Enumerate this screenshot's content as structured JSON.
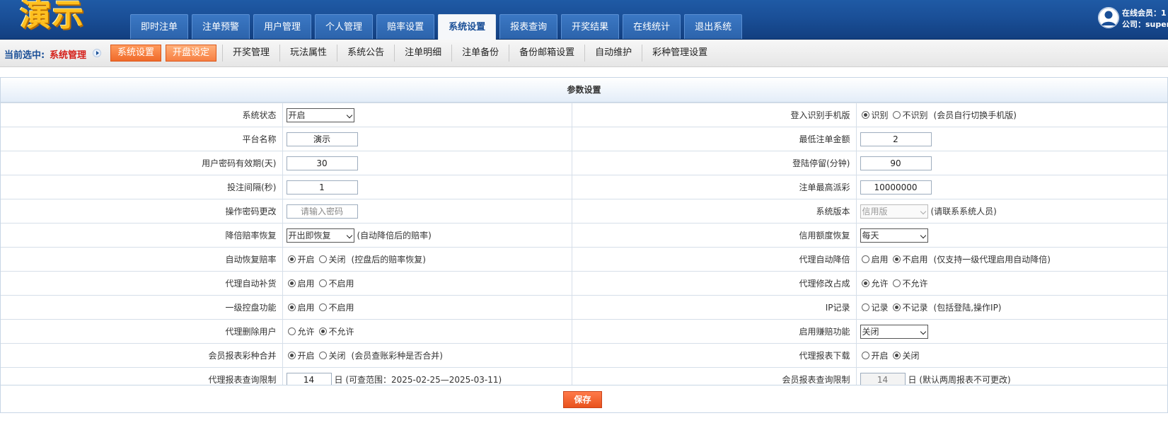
{
  "header": {
    "logo_text": "演示",
    "nav": [
      "即时注单",
      "注单预警",
      "用户管理",
      "个人管理",
      "赔率设置",
      "系统设置",
      "报表查询",
      "开奖结果",
      "在线统计",
      "退出系统"
    ],
    "active_nav": "系统设置",
    "online_label": "在线会员：1",
    "company_label": "公司：supers"
  },
  "subnav": {
    "current_label": "当前选中:",
    "current_value": "系统管理",
    "buttons": [
      "系统设置",
      "开盘设定"
    ],
    "links": [
      "开奖管理",
      "玩法属性",
      "系统公告",
      "注单明细",
      "注单备份",
      "备份邮箱设置",
      "自动维护",
      "彩种管理设置"
    ]
  },
  "panel": {
    "title": "参数设置",
    "rows": [
      {
        "left": {
          "label": "系统状态",
          "type": "select",
          "value": "开启"
        },
        "right": {
          "label": "登入识别手机版",
          "type": "radio",
          "options": [
            "识别",
            "不识别"
          ],
          "selected": 0,
          "note": "(会员自行切换手机版)"
        }
      },
      {
        "left": {
          "label": "平台名称",
          "type": "input",
          "value": "演示"
        },
        "right": {
          "label": "最低注单金额",
          "type": "input",
          "value": "2"
        }
      },
      {
        "left": {
          "label": "用户密码有效期(天)",
          "type": "input",
          "value": "30"
        },
        "right": {
          "label": "登陆停留(分钟)",
          "type": "input",
          "value": "90"
        }
      },
      {
        "left": {
          "label": "投注间隔(秒)",
          "type": "input",
          "value": "1"
        },
        "right": {
          "label": "注单最高派彩",
          "type": "input",
          "value": "10000000"
        }
      },
      {
        "left": {
          "label": "操作密码更改",
          "type": "input",
          "placeholder": "请输入密码"
        },
        "right": {
          "label": "系统版本",
          "type": "select-disabled",
          "value": "信用版",
          "note": "(请联系系统人员)"
        }
      },
      {
        "left": {
          "label": "降倍赔率恢复",
          "type": "select",
          "value": "开出即恢复",
          "note": "(自动降倍后的赔率)"
        },
        "right": {
          "label": "信用额度恢复",
          "type": "select",
          "value": "每天"
        }
      },
      {
        "left": {
          "label": "自动恢复赔率",
          "type": "radio",
          "options": [
            "开启",
            "关闭"
          ],
          "selected": 0,
          "note": "(控盘后的赔率恢复)"
        },
        "right": {
          "label": "代理自动降倍",
          "type": "radio",
          "options": [
            "启用",
            "不启用"
          ],
          "selected": 1,
          "note": "(仅支持一级代理启用自动降倍)"
        }
      },
      {
        "left": {
          "label": "代理自动补货",
          "type": "radio",
          "options": [
            "启用",
            "不启用"
          ],
          "selected": 0
        },
        "right": {
          "label": "代理修改占成",
          "type": "radio",
          "options": [
            "允许",
            "不允许"
          ],
          "selected": 0
        }
      },
      {
        "left": {
          "label": "一级控盘功能",
          "type": "radio",
          "options": [
            "启用",
            "不启用"
          ],
          "selected": 0
        },
        "right": {
          "label": "IP记录",
          "type": "radio",
          "options": [
            "记录",
            "不记录"
          ],
          "selected": 1,
          "note": "(包括登陆,操作IP)"
        }
      },
      {
        "left": {
          "label": "代理删除用户",
          "type": "radio",
          "options": [
            "允许",
            "不允许"
          ],
          "selected": 1
        },
        "right": {
          "label": "启用赚赔功能",
          "type": "select",
          "value": "关闭"
        }
      },
      {
        "left": {
          "label": "会员报表彩种合并",
          "type": "radio",
          "options": [
            "开启",
            "关闭"
          ],
          "selected": 0,
          "note": "(会员查账彩种是否合并)"
        },
        "right": {
          "label": "代理报表下载",
          "type": "radio",
          "options": [
            "开启",
            "关闭"
          ],
          "selected": 1
        }
      },
      {
        "left": {
          "label": "代理报表查询限制",
          "type": "input",
          "value": "14",
          "note": "日 (可查范围：2025-02-25—2025-03-11)"
        },
        "right": {
          "label": "会员报表查询限制",
          "type": "input-readonly",
          "value": "14",
          "note": "日 (默认两周报表不可更改)"
        }
      }
    ]
  },
  "footer": {
    "save_label": "保存"
  },
  "colors": {
    "header_blue": "#1a4f97",
    "accent_orange": "#f06a2a",
    "current_red": "#d5201a",
    "logo_yellow": "#ffc01f"
  }
}
